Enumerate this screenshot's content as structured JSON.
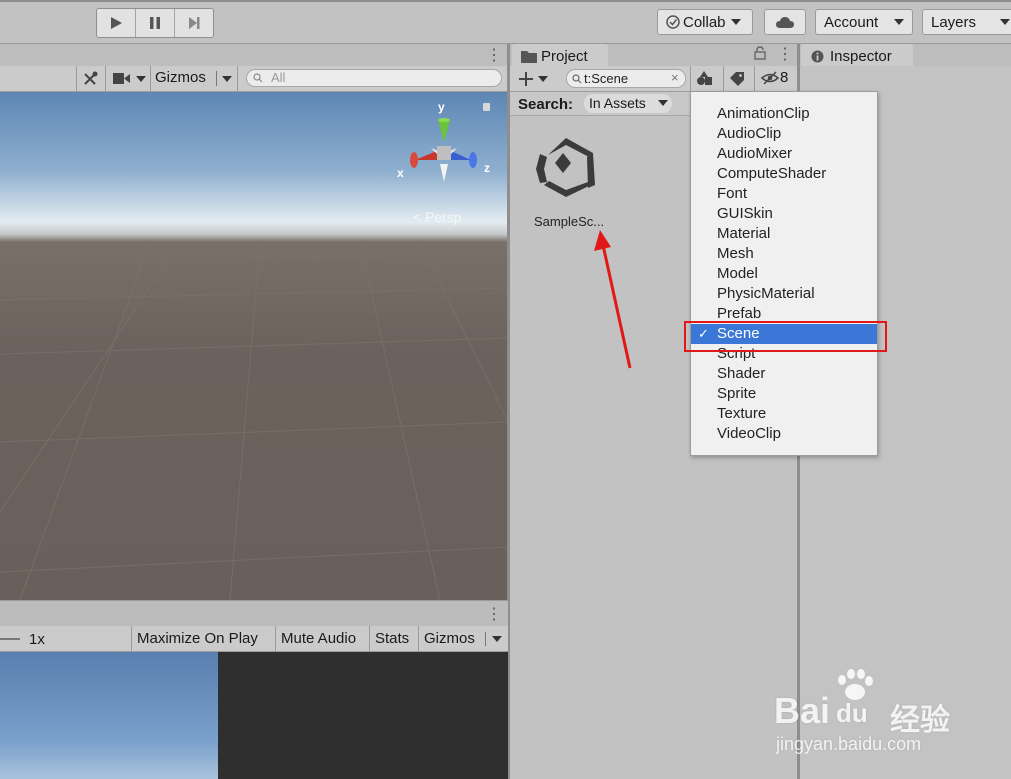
{
  "toolbar": {
    "collab_label": "Collab",
    "account_label": "Account",
    "layers_label": "Layers"
  },
  "scene": {
    "gizmos_label": "Gizmos",
    "search_placeholder": "All",
    "persp_label": "< Persp",
    "axis_y": "y",
    "axis_x": "x",
    "axis_z": "z"
  },
  "game": {
    "scale_label": "1x",
    "maximize_label": "Maximize On Play",
    "mute_label": "Mute Audio",
    "stats_label": "Stats",
    "gizmos_label": "Gizmos"
  },
  "project": {
    "tab_label": "Project",
    "search_value": "t:Scene",
    "hidden_count": "8",
    "search_label": "Search:",
    "scope_label": "In Assets",
    "asset_name": "SampleSc..."
  },
  "inspector": {
    "tab_label": "Inspector"
  },
  "type_filter_menu": {
    "items": [
      "AnimationClip",
      "AudioClip",
      "AudioMixer",
      "ComputeShader",
      "Font",
      "GUISkin",
      "Material",
      "Mesh",
      "Model",
      "PhysicMaterial",
      "Prefab",
      "Scene",
      "Script",
      "Shader",
      "Sprite",
      "Texture",
      "VideoClip"
    ],
    "selected": "Scene",
    "check_mark": "✓"
  },
  "watermark": {
    "brand": "Bai",
    "brand_suffix": "du",
    "cn_text": "经验",
    "url": "jingyan.baidu.com"
  },
  "colors": {
    "selection": "#3a77d6",
    "annotation_red": "#e01818"
  }
}
